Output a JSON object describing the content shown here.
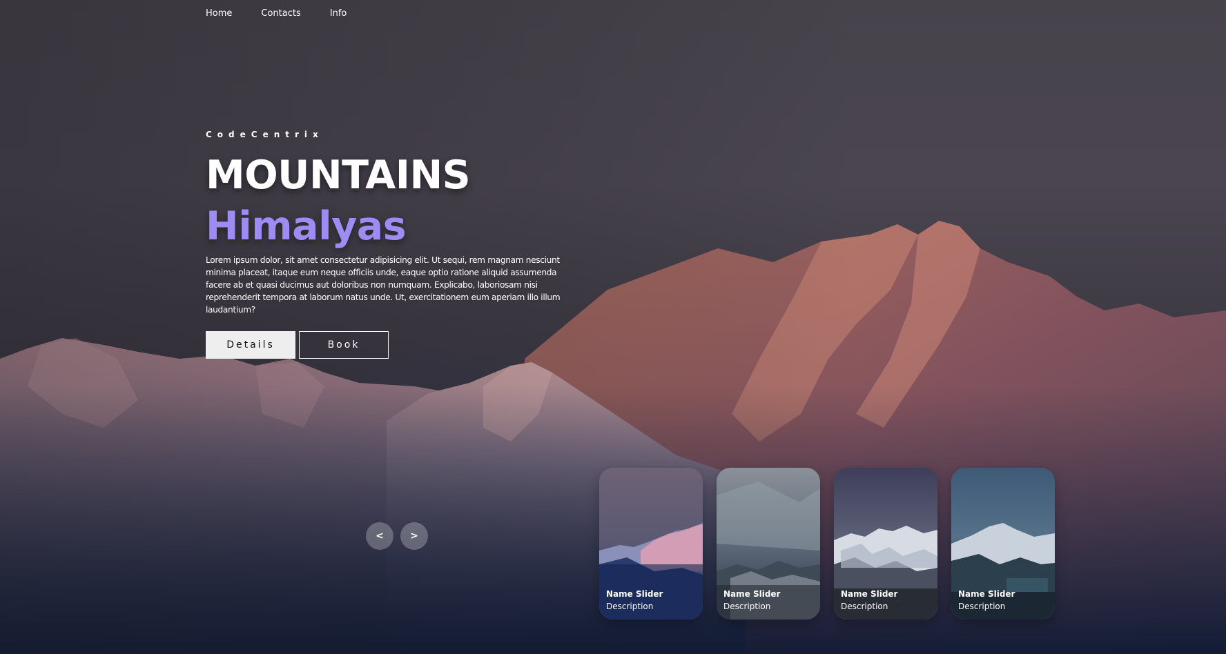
{
  "nav": {
    "items": [
      {
        "label": "Home"
      },
      {
        "label": "Contacts"
      },
      {
        "label": "Info"
      }
    ]
  },
  "hero": {
    "author": "CodeCentrix",
    "title": "MOUNTAINS",
    "topic": "Himalyas",
    "description": "Lorem ipsum dolor, sit amet consectetur adipisicing elit. Ut sequi, rem magnam nesciunt minima placeat, itaque eum neque officiis unde, eaque optio ratione aliquid assumenda facere ab et quasi ducimus aut doloribus non numquam. Explicabo, laboriosam nisi reprehenderit tempora at laborum natus unde. Ut, exercitationem eum aperiam illo illum laudantium?",
    "buttons": {
      "details": "Details",
      "book": "Book"
    }
  },
  "arrows": {
    "prev": "<",
    "next": ">"
  },
  "thumbnails": [
    {
      "title": "Name Slider",
      "description": "Description"
    },
    {
      "title": "Name Slider",
      "description": "Description"
    },
    {
      "title": "Name Slider",
      "description": "Description"
    },
    {
      "title": "Name Slider",
      "description": "Description"
    }
  ],
  "colors": {
    "accent": "#9d8cf2",
    "text": "#ffffff",
    "button_light": "#eeeeee"
  },
  "icons": {
    "prev": "chevron-left-icon",
    "next": "chevron-right-icon"
  }
}
